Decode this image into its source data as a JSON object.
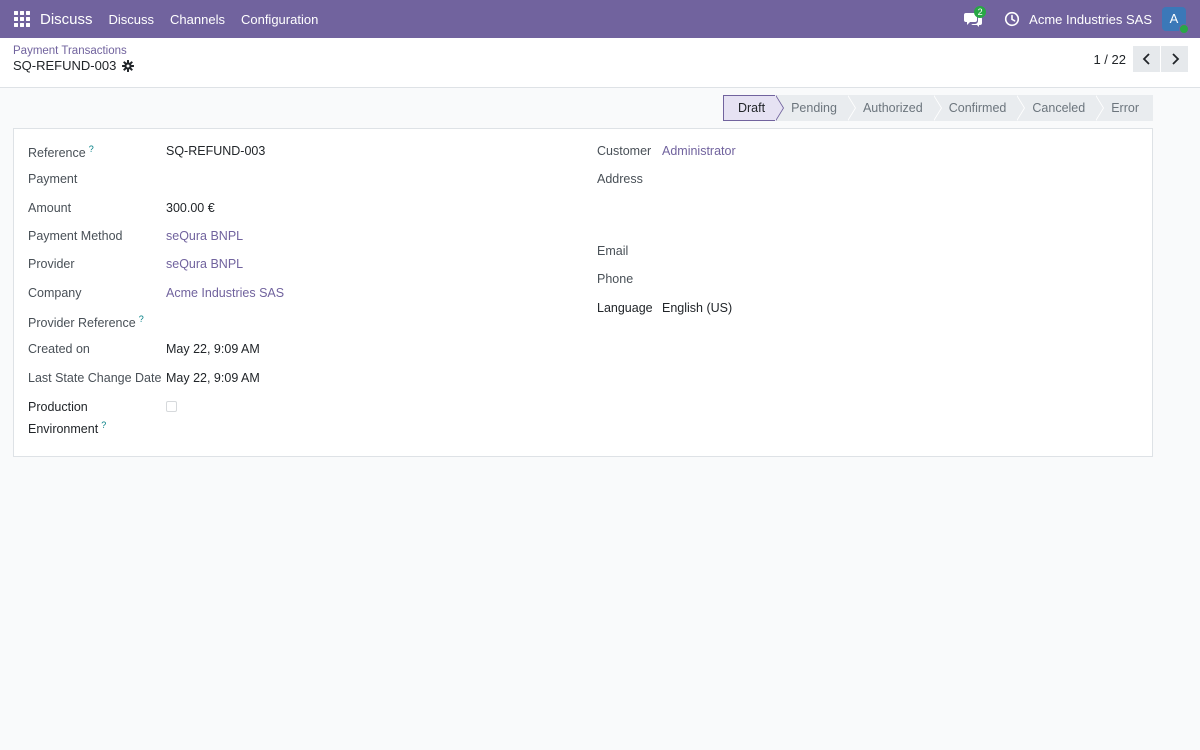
{
  "navbar": {
    "app_name": "Discuss",
    "menu": [
      "Discuss",
      "Channels",
      "Configuration"
    ],
    "chat_count": "2",
    "company": "Acme Industries SAS",
    "avatar_letter": "A",
    "accent_color": "#71639e"
  },
  "control_panel": {
    "breadcrumb": "Payment Transactions",
    "record_title": "SQ-REFUND-003",
    "pager": "1 / 22"
  },
  "statusbar": {
    "stages": [
      "Draft",
      "Pending",
      "Authorized",
      "Confirmed",
      "Canceled",
      "Error"
    ],
    "active": "Draft"
  },
  "form": {
    "left": {
      "reference_label": "Reference",
      "reference_value": "SQ-REFUND-003",
      "payment_label": "Payment",
      "amount_label": "Amount",
      "amount_value": "300.00 €",
      "payment_method_label": "Payment Method",
      "payment_method_value": "seQura BNPL",
      "provider_label": "Provider",
      "provider_value": "seQura BNPL",
      "company_label": "Company",
      "company_value": "Acme Industries SAS",
      "provider_reference_label": "Provider Reference",
      "created_on_label": "Created on",
      "created_on_value": "May 22, 9:09 AM",
      "last_state_change_label": "Last State Change Date",
      "last_state_change_value": "May 22, 9:09 AM",
      "production_label_1": "Production",
      "production_label_2": "Environment",
      "help_mark": "?"
    },
    "right": {
      "customer_label": "Customer",
      "customer_value": "Administrator",
      "address_label": "Address",
      "email_label": "Email",
      "phone_label": "Phone",
      "language_label": "Language",
      "language_value": "English (US)"
    }
  },
  "icons": {
    "apps": "apps-grid-icon",
    "chat": "chat-icon",
    "clock": "clock-icon",
    "gear": "gear-icon",
    "prev": "chevron-left-icon",
    "next": "chevron-right-icon"
  }
}
